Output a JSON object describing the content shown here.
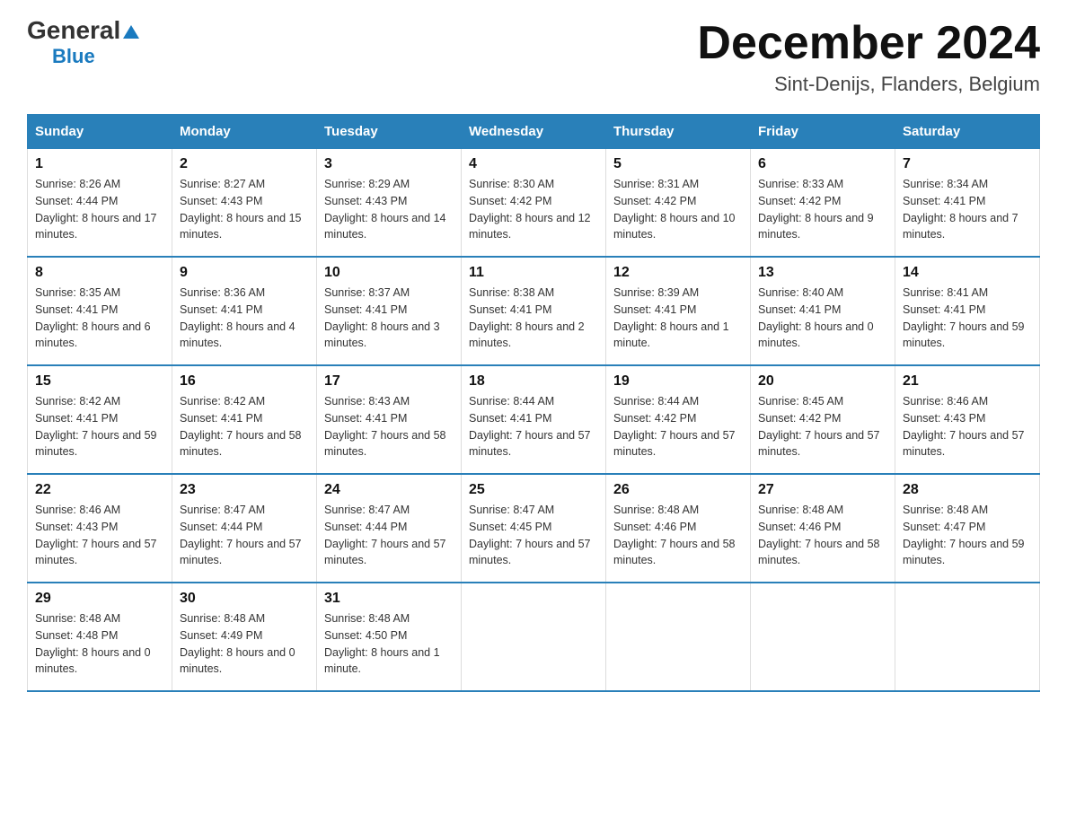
{
  "header": {
    "logo_general": "General",
    "logo_blue": "Blue",
    "month_title": "December 2024",
    "location": "Sint-Denijs, Flanders, Belgium"
  },
  "days_of_week": [
    "Sunday",
    "Monday",
    "Tuesday",
    "Wednesday",
    "Thursday",
    "Friday",
    "Saturday"
  ],
  "weeks": [
    [
      {
        "day": "1",
        "sunrise": "8:26 AM",
        "sunset": "4:44 PM",
        "daylight": "8 hours and 17 minutes."
      },
      {
        "day": "2",
        "sunrise": "8:27 AM",
        "sunset": "4:43 PM",
        "daylight": "8 hours and 15 minutes."
      },
      {
        "day": "3",
        "sunrise": "8:29 AM",
        "sunset": "4:43 PM",
        "daylight": "8 hours and 14 minutes."
      },
      {
        "day": "4",
        "sunrise": "8:30 AM",
        "sunset": "4:42 PM",
        "daylight": "8 hours and 12 minutes."
      },
      {
        "day": "5",
        "sunrise": "8:31 AM",
        "sunset": "4:42 PM",
        "daylight": "8 hours and 10 minutes."
      },
      {
        "day": "6",
        "sunrise": "8:33 AM",
        "sunset": "4:42 PM",
        "daylight": "8 hours and 9 minutes."
      },
      {
        "day": "7",
        "sunrise": "8:34 AM",
        "sunset": "4:41 PM",
        "daylight": "8 hours and 7 minutes."
      }
    ],
    [
      {
        "day": "8",
        "sunrise": "8:35 AM",
        "sunset": "4:41 PM",
        "daylight": "8 hours and 6 minutes."
      },
      {
        "day": "9",
        "sunrise": "8:36 AM",
        "sunset": "4:41 PM",
        "daylight": "8 hours and 4 minutes."
      },
      {
        "day": "10",
        "sunrise": "8:37 AM",
        "sunset": "4:41 PM",
        "daylight": "8 hours and 3 minutes."
      },
      {
        "day": "11",
        "sunrise": "8:38 AM",
        "sunset": "4:41 PM",
        "daylight": "8 hours and 2 minutes."
      },
      {
        "day": "12",
        "sunrise": "8:39 AM",
        "sunset": "4:41 PM",
        "daylight": "8 hours and 1 minute."
      },
      {
        "day": "13",
        "sunrise": "8:40 AM",
        "sunset": "4:41 PM",
        "daylight": "8 hours and 0 minutes."
      },
      {
        "day": "14",
        "sunrise": "8:41 AM",
        "sunset": "4:41 PM",
        "daylight": "7 hours and 59 minutes."
      }
    ],
    [
      {
        "day": "15",
        "sunrise": "8:42 AM",
        "sunset": "4:41 PM",
        "daylight": "7 hours and 59 minutes."
      },
      {
        "day": "16",
        "sunrise": "8:42 AM",
        "sunset": "4:41 PM",
        "daylight": "7 hours and 58 minutes."
      },
      {
        "day": "17",
        "sunrise": "8:43 AM",
        "sunset": "4:41 PM",
        "daylight": "7 hours and 58 minutes."
      },
      {
        "day": "18",
        "sunrise": "8:44 AM",
        "sunset": "4:41 PM",
        "daylight": "7 hours and 57 minutes."
      },
      {
        "day": "19",
        "sunrise": "8:44 AM",
        "sunset": "4:42 PM",
        "daylight": "7 hours and 57 minutes."
      },
      {
        "day": "20",
        "sunrise": "8:45 AM",
        "sunset": "4:42 PM",
        "daylight": "7 hours and 57 minutes."
      },
      {
        "day": "21",
        "sunrise": "8:46 AM",
        "sunset": "4:43 PM",
        "daylight": "7 hours and 57 minutes."
      }
    ],
    [
      {
        "day": "22",
        "sunrise": "8:46 AM",
        "sunset": "4:43 PM",
        "daylight": "7 hours and 57 minutes."
      },
      {
        "day": "23",
        "sunrise": "8:47 AM",
        "sunset": "4:44 PM",
        "daylight": "7 hours and 57 minutes."
      },
      {
        "day": "24",
        "sunrise": "8:47 AM",
        "sunset": "4:44 PM",
        "daylight": "7 hours and 57 minutes."
      },
      {
        "day": "25",
        "sunrise": "8:47 AM",
        "sunset": "4:45 PM",
        "daylight": "7 hours and 57 minutes."
      },
      {
        "day": "26",
        "sunrise": "8:48 AM",
        "sunset": "4:46 PM",
        "daylight": "7 hours and 58 minutes."
      },
      {
        "day": "27",
        "sunrise": "8:48 AM",
        "sunset": "4:46 PM",
        "daylight": "7 hours and 58 minutes."
      },
      {
        "day": "28",
        "sunrise": "8:48 AM",
        "sunset": "4:47 PM",
        "daylight": "7 hours and 59 minutes."
      }
    ],
    [
      {
        "day": "29",
        "sunrise": "8:48 AM",
        "sunset": "4:48 PM",
        "daylight": "8 hours and 0 minutes."
      },
      {
        "day": "30",
        "sunrise": "8:48 AM",
        "sunset": "4:49 PM",
        "daylight": "8 hours and 0 minutes."
      },
      {
        "day": "31",
        "sunrise": "8:48 AM",
        "sunset": "4:50 PM",
        "daylight": "8 hours and 1 minute."
      },
      null,
      null,
      null,
      null
    ]
  ]
}
